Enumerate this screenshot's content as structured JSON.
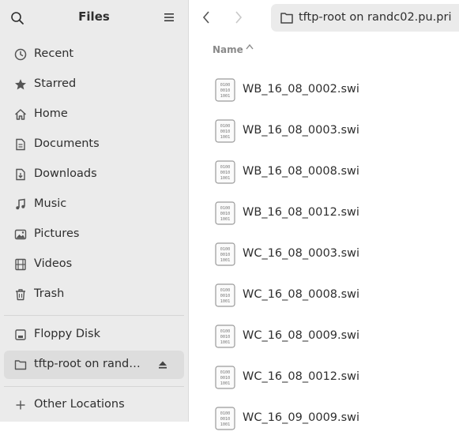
{
  "sidebar": {
    "title": "Files",
    "places": [
      {
        "label": "Recent",
        "icon": "clock-icon"
      },
      {
        "label": "Starred",
        "icon": "star-icon"
      },
      {
        "label": "Home",
        "icon": "home-icon"
      },
      {
        "label": "Documents",
        "icon": "document-icon"
      },
      {
        "label": "Downloads",
        "icon": "download-icon"
      },
      {
        "label": "Music",
        "icon": "music-icon"
      },
      {
        "label": "Pictures",
        "icon": "picture-icon"
      },
      {
        "label": "Videos",
        "icon": "film-icon"
      },
      {
        "label": "Trash",
        "icon": "trash-icon"
      }
    ],
    "devices": [
      {
        "label": "Floppy Disk",
        "icon": "disk-icon"
      },
      {
        "label": "tftp-root on randc02.pu.pri",
        "icon": "network-share-icon"
      }
    ],
    "other_locations": "Other Locations"
  },
  "pathbar": {
    "label": "tftp-root on randc02.pu.pri"
  },
  "columns": {
    "name": "Name"
  },
  "files": [
    {
      "name": "WB_16_08_0002.swi"
    },
    {
      "name": "WB_16_08_0003.swi"
    },
    {
      "name": "WB_16_08_0008.swi"
    },
    {
      "name": "WB_16_08_0012.swi"
    },
    {
      "name": "WC_16_08_0003.swi"
    },
    {
      "name": "WC_16_08_0008.swi"
    },
    {
      "name": "WC_16_08_0009.swi"
    },
    {
      "name": "WC_16_08_0012.swi"
    },
    {
      "name": "WC_16_09_0009.swi"
    }
  ],
  "colors": {
    "sidebar_bg": "#ebebeb",
    "active_bg": "#dddddd",
    "text": "#2e2e2e",
    "muted": "#8a8a8a"
  }
}
